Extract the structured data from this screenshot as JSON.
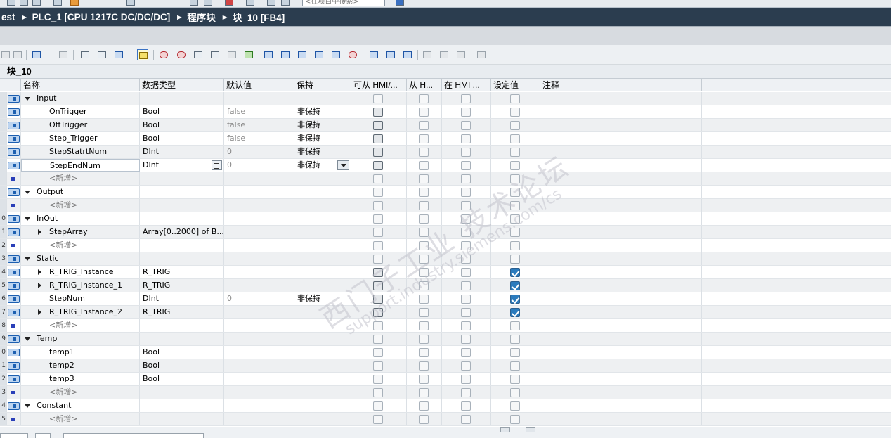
{
  "top_toolbar": {
    "go_online_label": "转至在线",
    "go_offline_label": "转至离线",
    "search_placeholder": "<在项目中搜索>"
  },
  "breadcrumb": {
    "items": [
      "est",
      "PLC_1 [CPU 1217C DC/DC/DC]",
      "程序块",
      "块_10 [FB4]"
    ]
  },
  "editor": {
    "block_title": "块_10"
  },
  "columns": {
    "name": "名称",
    "data_type": "数据类型",
    "default": "默认值",
    "retain": "保持",
    "hmi_access": "可从 HMI/...",
    "hmi_write": "从 H...",
    "hmi_visible": "在 HMI ...",
    "setpoint": "设定值",
    "comment": "注释"
  },
  "rows": [
    {
      "num": "",
      "kind": "section",
      "name": "Input",
      "dtype": "",
      "default": "",
      "retain": "",
      "cbs": [
        0,
        0,
        0,
        0
      ],
      "alt": true
    },
    {
      "num": "",
      "kind": "var",
      "name": "OnTrigger",
      "dtype": "Bool",
      "default": "false",
      "retain": "非保持",
      "cbs": [
        2,
        0,
        0,
        0
      ]
    },
    {
      "num": "",
      "kind": "var",
      "name": "OffTrigger",
      "dtype": "Bool",
      "default": "false",
      "retain": "非保持",
      "cbs": [
        2,
        0,
        0,
        0
      ],
      "alt": true
    },
    {
      "num": "",
      "kind": "var",
      "name": "Step_Trigger",
      "dtype": "Bool",
      "default": "false",
      "retain": "非保持",
      "cbs": [
        2,
        0,
        0,
        0
      ]
    },
    {
      "num": "",
      "kind": "var",
      "name": "StepStatrtNum",
      "dtype": "DInt",
      "default": "0",
      "retain": "非保持",
      "cbs": [
        2,
        0,
        0,
        0
      ],
      "alt": true
    },
    {
      "num": "",
      "kind": "var",
      "name": "StepEndNum",
      "dtype": "DInt",
      "default": "0",
      "retain": "非保持",
      "cbs": [
        2,
        0,
        0,
        0
      ],
      "editing": true
    },
    {
      "num": "",
      "kind": "add",
      "name": "<新增>",
      "dtype": "",
      "default": "",
      "retain": "",
      "cbs": [
        1,
        1,
        1,
        1
      ],
      "alt": true
    },
    {
      "num": "",
      "kind": "section",
      "name": "Output",
      "dtype": "",
      "default": "",
      "retain": "",
      "cbs": [
        0,
        0,
        0,
        0
      ]
    },
    {
      "num": "",
      "kind": "add",
      "name": "<新增>",
      "dtype": "",
      "default": "",
      "retain": "",
      "cbs": [
        1,
        1,
        1,
        1
      ],
      "alt": true
    },
    {
      "num": "0",
      "kind": "section",
      "name": "InOut",
      "dtype": "",
      "default": "",
      "retain": "",
      "cbs": [
        0,
        0,
        0,
        0
      ]
    },
    {
      "num": "1",
      "kind": "struct",
      "name": "StepArray",
      "dtype": "Array[0..2000] of B...",
      "default": "",
      "retain": "",
      "cbs": [
        0,
        0,
        0,
        0
      ],
      "alt": true
    },
    {
      "num": "2",
      "kind": "add",
      "name": "<新增>",
      "dtype": "",
      "default": "",
      "retain": "",
      "cbs": [
        1,
        1,
        1,
        1
      ]
    },
    {
      "num": "3",
      "kind": "section",
      "name": "Static",
      "dtype": "",
      "default": "",
      "retain": "",
      "cbs": [
        0,
        0,
        0,
        0
      ],
      "alt": true
    },
    {
      "num": "4",
      "kind": "struct",
      "name": "R_TRIG_Instance",
      "dtype": "R_TRIG",
      "default": "",
      "retain": "",
      "cbs": [
        2,
        0,
        0,
        3
      ]
    },
    {
      "num": "5",
      "kind": "struct",
      "name": "R_TRIG_Instance_1",
      "dtype": "R_TRIG",
      "default": "",
      "retain": "",
      "cbs": [
        2,
        0,
        0,
        3
      ],
      "alt": true
    },
    {
      "num": "6",
      "kind": "var",
      "name": "StepNum",
      "dtype": "DInt",
      "default": "0",
      "retain": "非保持",
      "cbs": [
        2,
        0,
        0,
        3
      ]
    },
    {
      "num": "7",
      "kind": "struct",
      "name": "R_TRIG_Instance_2",
      "dtype": "R_TRIG",
      "default": "",
      "retain": "",
      "cbs": [
        2,
        0,
        0,
        3
      ],
      "alt": true
    },
    {
      "num": "8",
      "kind": "add",
      "name": "<新增>",
      "dtype": "",
      "default": "",
      "retain": "",
      "cbs": [
        1,
        1,
        1,
        1
      ]
    },
    {
      "num": "9",
      "kind": "section",
      "name": "Temp",
      "dtype": "",
      "default": "",
      "retain": "",
      "cbs": [
        0,
        0,
        0,
        0
      ],
      "alt": true
    },
    {
      "num": "0",
      "kind": "var",
      "name": "temp1",
      "dtype": "Bool",
      "default": "",
      "retain": "",
      "cbs": [
        0,
        0,
        0,
        0
      ]
    },
    {
      "num": "1",
      "kind": "var",
      "name": "temp2",
      "dtype": "Bool",
      "default": "",
      "retain": "",
      "cbs": [
        0,
        0,
        0,
        0
      ],
      "alt": true
    },
    {
      "num": "2",
      "kind": "var",
      "name": "temp3",
      "dtype": "Bool",
      "default": "",
      "retain": "",
      "cbs": [
        0,
        0,
        0,
        0
      ]
    },
    {
      "num": "3",
      "kind": "add",
      "name": "<新增>",
      "dtype": "",
      "default": "",
      "retain": "",
      "cbs": [
        1,
        1,
        1,
        1
      ],
      "alt": true
    },
    {
      "num": "4",
      "kind": "section",
      "name": "Constant",
      "dtype": "",
      "default": "",
      "retain": "",
      "cbs": [
        0,
        0,
        0,
        0
      ]
    },
    {
      "num": "5",
      "kind": "add",
      "name": "<新增>",
      "dtype": "",
      "default": "",
      "retain": "",
      "cbs": [
        1,
        1,
        1,
        1
      ],
      "alt": true
    }
  ],
  "watermark": {
    "main": "西门子工业 技术论坛",
    "sub": "support.industry.siemens.com/cs"
  }
}
